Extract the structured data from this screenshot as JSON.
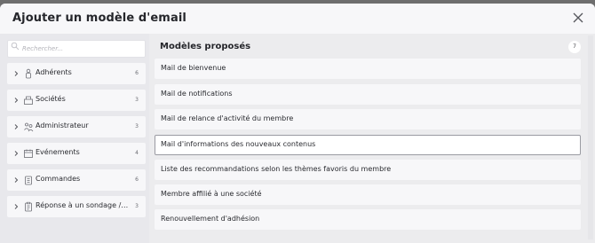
{
  "modal": {
    "title": "Ajouter un modèle d'email",
    "close_icon": "close-icon"
  },
  "search": {
    "placeholder": "Rechercher..."
  },
  "categories": [
    {
      "label": "Adhérents",
      "count": "6",
      "icon": "person-icon"
    },
    {
      "label": "Sociétés",
      "count": "3",
      "icon": "building-icon"
    },
    {
      "label": "Administrateur",
      "count": "3",
      "icon": "admins-icon"
    },
    {
      "label": "Evénements",
      "count": "4",
      "icon": "calendar-icon"
    },
    {
      "label": "Commandes",
      "count": "6",
      "icon": "clipboard-icon"
    },
    {
      "label": "Réponse à un sondage / q...",
      "count": "3",
      "icon": "survey-icon"
    }
  ],
  "templates": {
    "title": "Modèles proposés",
    "count": "7",
    "items": [
      "Mail de bienvenue",
      "Mail de notifications",
      "Mail de relance d'activité du membre",
      "Mail d'informations des nouveaux contenus",
      "Liste des recommandations selon les thèmes favoris du membre",
      "Membre affilié à une société",
      "Renouvellement d'adhésion"
    ],
    "selected_index": 3
  }
}
